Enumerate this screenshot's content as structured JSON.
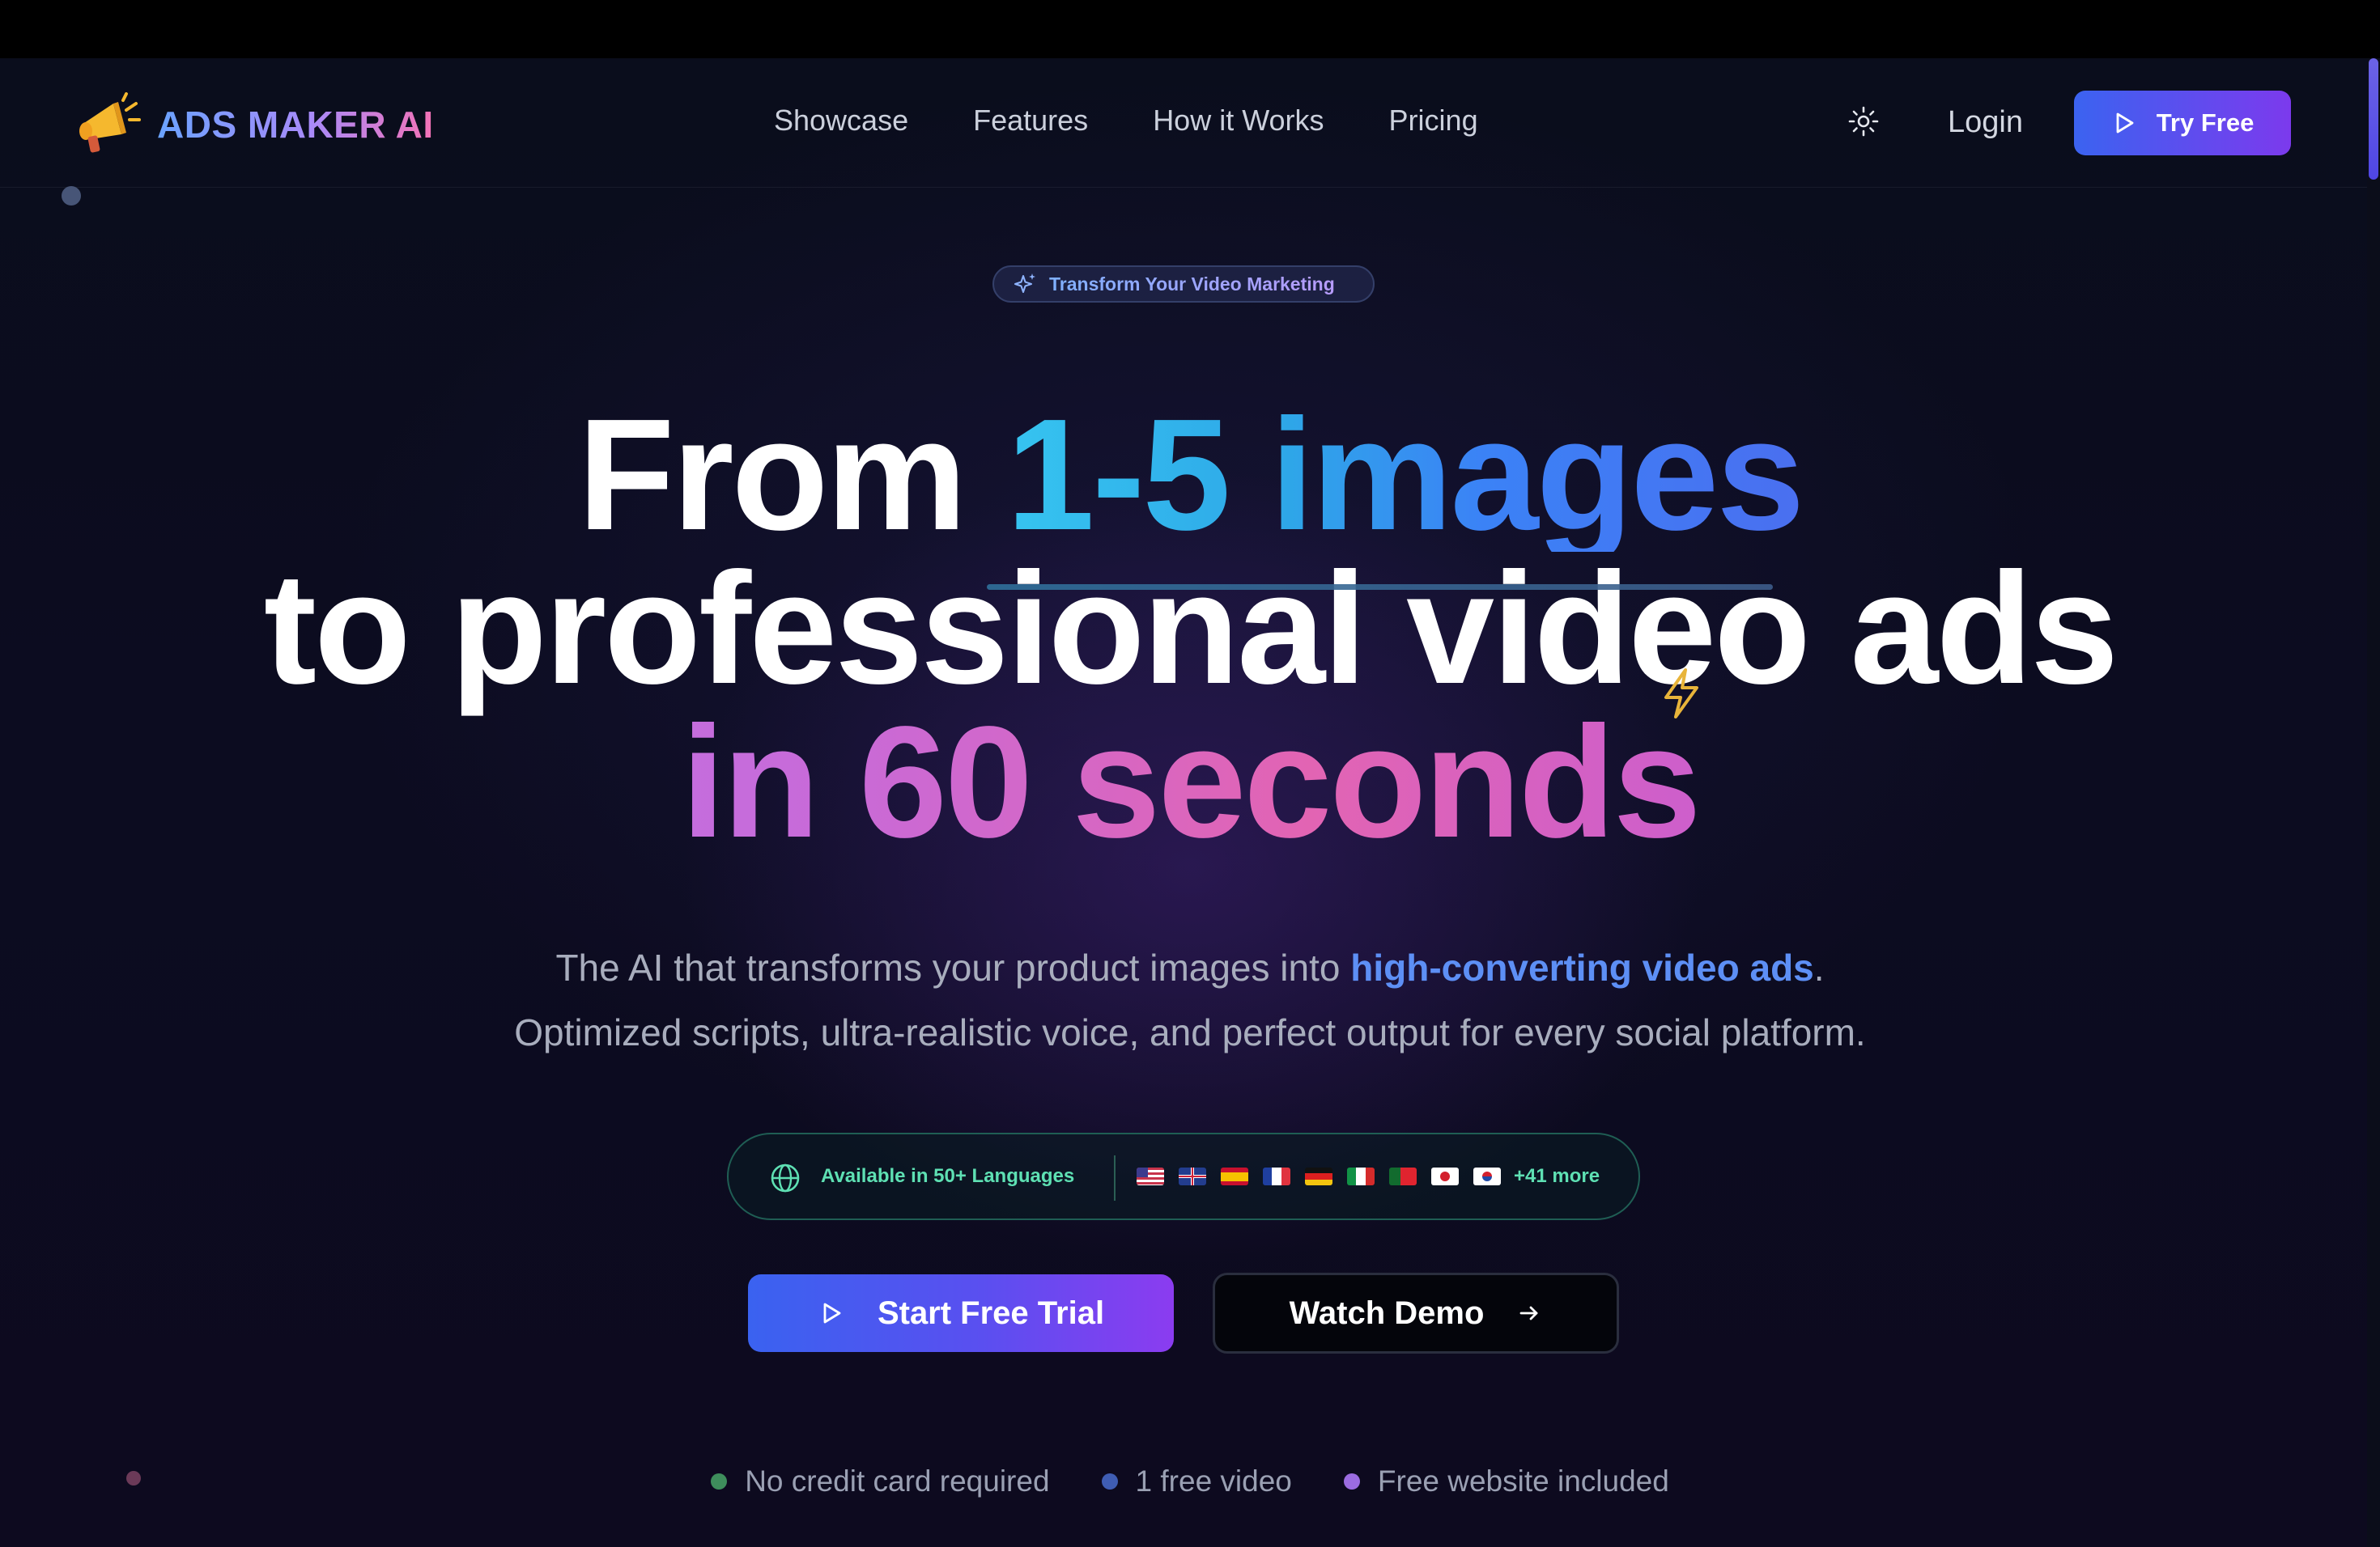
{
  "nav": {
    "brand": "ADS MAKER AI",
    "links": [
      "Showcase",
      "Features",
      "How it Works",
      "Pricing"
    ],
    "login": "Login",
    "try_free": "Try Free"
  },
  "hero": {
    "badge": "Transform Your Video Marketing",
    "headline": {
      "line1_white": "From ",
      "line1_accent": "1-5 images",
      "line2": "to professional video ads",
      "line3": "in 60 seconds"
    },
    "subtitle": {
      "part1": "The AI that transforms your product images into ",
      "highlight": "high-converting video ads",
      "part2": ".",
      "line2": "Optimized scripts, ultra-realistic voice, and perfect output for every social platform."
    },
    "languages": {
      "label": "Available in 50+ Languages",
      "more": "+41 more",
      "flags": [
        "us",
        "gb",
        "es",
        "fr",
        "de",
        "it",
        "pt",
        "jp",
        "kr"
      ]
    },
    "cta_primary": "Start Free Trial",
    "cta_secondary": "Watch Demo",
    "perks": [
      {
        "label": "No credit card required",
        "color": "#3e8e5c"
      },
      {
        "label": "1 free video",
        "color": "#3f5db3"
      },
      {
        "label": "Free website included",
        "color": "#9b6ce0"
      }
    ]
  },
  "colors": {
    "accent": "#4f46e5",
    "brand_gradient": [
      "#6aa3ff",
      "#a78bfa",
      "#f472b6"
    ],
    "language_accent": "#5ee0b3"
  }
}
